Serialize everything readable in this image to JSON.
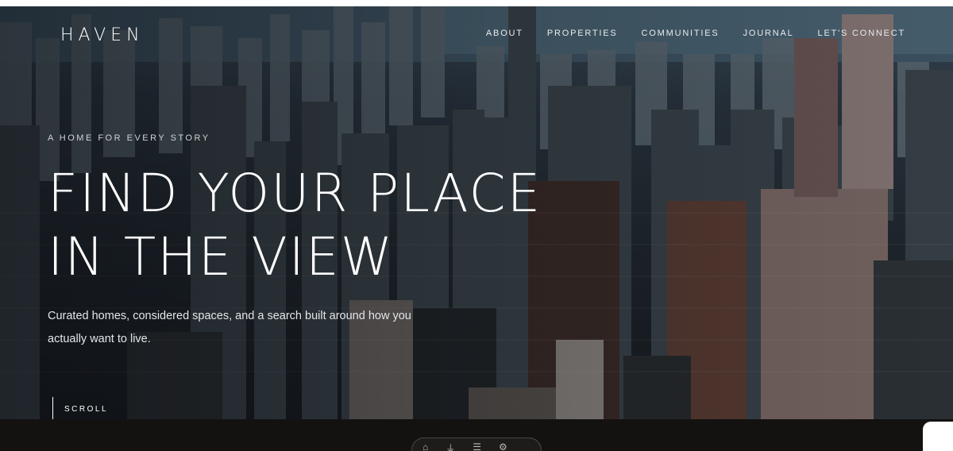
{
  "brand": {
    "logo": "HAVEN"
  },
  "nav": {
    "items": [
      "ABOUT",
      "PROPERTIES",
      "COMMUNITIES",
      "JOURNAL",
      "LET'S CONNECT"
    ]
  },
  "hero": {
    "eyebrow": "A HOME FOR EVERY STORY",
    "headline_line1": "FIND YOUR PLACE",
    "headline_line2": "IN THE VIEW",
    "subtext": "Curated homes, considered spaces, and a search built around how you actually want to live."
  },
  "scroll": {
    "label": "SCROLL"
  },
  "colors": {
    "footer_bg": "#141211",
    "text": "#ffffff"
  }
}
